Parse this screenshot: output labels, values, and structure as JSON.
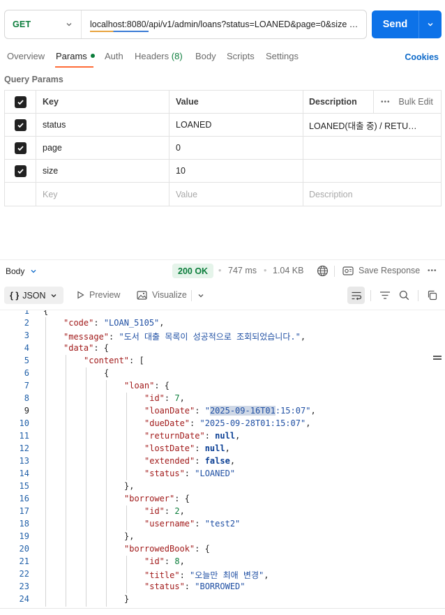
{
  "request": {
    "method": "GET",
    "url": "localhost:8080/api/v1/admin/loans?status=LOANED&page=0&size …",
    "send_label": "Send"
  },
  "tabs": {
    "overview": "Overview",
    "params": "Params",
    "auth": "Auth",
    "headers": "Headers",
    "headers_count": "(8)",
    "body": "Body",
    "scripts": "Scripts",
    "settings": "Settings",
    "cookies": "Cookies"
  },
  "params": {
    "section_title": "Query Params",
    "columns": {
      "key": "Key",
      "value": "Value",
      "description": "Description",
      "bulk_edit": "Bulk Edit"
    },
    "rows": [
      {
        "key": "status",
        "value": "LOANED",
        "description": "LOANED(대출 중) / RETU…"
      },
      {
        "key": "page",
        "value": "0",
        "description": ""
      },
      {
        "key": "size",
        "value": "10",
        "description": ""
      }
    ],
    "placeholders": {
      "key": "Key",
      "value": "Value",
      "description": "Description"
    }
  },
  "response": {
    "body_label": "Body",
    "status": "200 OK",
    "time": "747 ms",
    "size": "1.04 KB",
    "save_label": "Save Response",
    "format": "JSON",
    "preview_label": "Preview",
    "visualize_label": "Visualize"
  },
  "editor": {
    "line_numbers": [
      "1",
      "2",
      "3",
      "4",
      "5",
      "6",
      "7",
      "8",
      "9",
      "10",
      "11",
      "12",
      "13",
      "14",
      "15",
      "16",
      "17",
      "18",
      "19",
      "20",
      "21",
      "22",
      "23",
      "24"
    ],
    "current_line": "9",
    "line1": "{",
    "code_key": "\"code\"",
    "code_val": "\"LOAN_5105\"",
    "message_key": "\"message\"",
    "message_val": "\"도서 대출 목록이 성공적으로 조회되었습니다.\"",
    "data_key": "\"data\"",
    "content_key": "\"content\"",
    "loan_key": "\"loan\"",
    "id_key": "\"id\"",
    "loan_id": "7",
    "loanDate_key": "\"loanDate\"",
    "loanDate_hl": "2025-09-16T01",
    "loanDate_rest": ":15:07\"",
    "dueDate_key": "\"dueDate\"",
    "dueDate_val": "\"2025-09-28T01:15:07\"",
    "returnDate_key": "\"returnDate\"",
    "lostDate_key": "\"lostDate\"",
    "extended_key": "\"extended\"",
    "extended_val": "false",
    "null_val": "null",
    "status_key": "\"status\"",
    "status_val": "\"LOANED\"",
    "borrower_key": "\"borrower\"",
    "borrower_id": "2",
    "username_key": "\"username\"",
    "username_val": "\"test2\"",
    "borrowedBook_key": "\"borrowedBook\"",
    "book_id": "8",
    "title_key": "\"title\"",
    "title_val": "\"오늘만 최애 변경\"",
    "book_status_val": "\"BORROWED\""
  }
}
